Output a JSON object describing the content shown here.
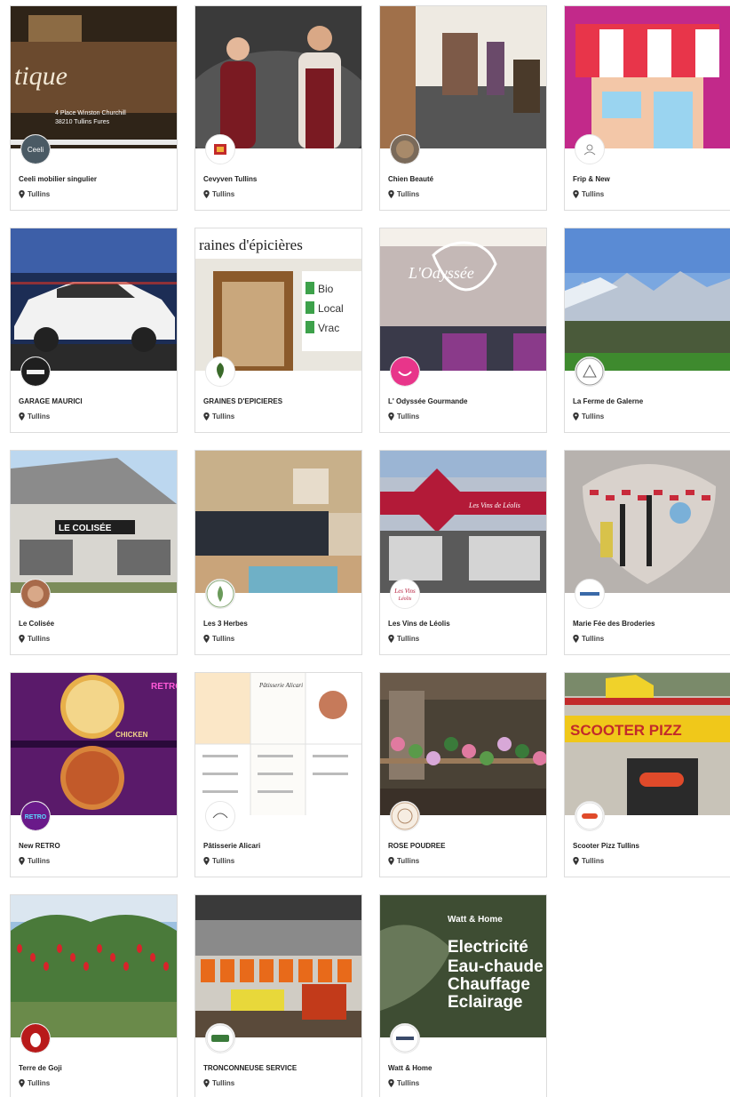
{
  "shops": [
    {
      "name": "Ceeli mobilier singulier",
      "city": "Tullins",
      "logo_text": "Ceeli",
      "cover_text": [
        "tique",
        "4 Place Winston Churchill",
        "38210 Tullins Fures"
      ]
    },
    {
      "name": "Cevyven Tullins",
      "city": "Tullins",
      "logo_text": "",
      "cover_text": []
    },
    {
      "name": "Chien Beauté",
      "city": "Tullins",
      "logo_text": "",
      "cover_text": []
    },
    {
      "name": "Frip & New",
      "city": "Tullins",
      "logo_text": "",
      "cover_text": []
    },
    {
      "name": "GARAGE MAURICI",
      "city": "Tullins",
      "logo_text": "",
      "cover_text": []
    },
    {
      "name": "GRAINES D'EPICIERES",
      "city": "Tullins",
      "logo_text": "",
      "cover_text": [
        "raines d'épicières",
        "Bio",
        "Local",
        "Vrac"
      ]
    },
    {
      "name": "L' Odyssée Gourmande",
      "city": "Tullins",
      "logo_text": "",
      "cover_text": [
        "L'Odyssée"
      ]
    },
    {
      "name": "La Ferme de Galerne",
      "city": "Tullins",
      "logo_text": "",
      "cover_text": []
    },
    {
      "name": "Le Colisée",
      "city": "Tullins",
      "logo_text": "",
      "cover_text": [
        "LE COLISÉE"
      ]
    },
    {
      "name": "Les 3 Herbes",
      "city": "Tullins",
      "logo_text": "",
      "cover_text": []
    },
    {
      "name": "Les Vins de Léolis",
      "city": "Tullins",
      "logo_text": "Les Vins",
      "cover_text": [
        "Les Vins de Léolis"
      ]
    },
    {
      "name": "Marie Fée des Broderies",
      "city": "Tullins",
      "logo_text": "",
      "cover_text": []
    },
    {
      "name": "New RETRO",
      "city": "Tullins",
      "logo_text": "RETRO",
      "cover_text": [
        "RETRO",
        "CHICKEN"
      ]
    },
    {
      "name": "Pâtisserie Alicari",
      "city": "Tullins",
      "logo_text": "",
      "cover_text": [
        "Pâtisserie Alicari"
      ]
    },
    {
      "name": "ROSE POUDREE",
      "city": "Tullins",
      "logo_text": "",
      "cover_text": []
    },
    {
      "name": "Scooter Pizz Tullins",
      "city": "Tullins",
      "logo_text": "",
      "cover_text": [
        "SCOOTER PIZZ"
      ]
    },
    {
      "name": "Terre de Goji",
      "city": "Tullins",
      "logo_text": "",
      "cover_text": []
    },
    {
      "name": "TRONCONNEUSE SERVICE",
      "city": "Tullins",
      "logo_text": "",
      "cover_text": []
    },
    {
      "name": "Watt & Home",
      "city": "Tullins",
      "logo_text": "",
      "cover_text": [
        "Watt & Home",
        "Electricité",
        "Eau-chaude",
        "Chauffage",
        "Eclairage"
      ]
    }
  ],
  "colors": {
    "card_border": "#dcdcdc",
    "text": "#222222",
    "pin": "#333333"
  }
}
